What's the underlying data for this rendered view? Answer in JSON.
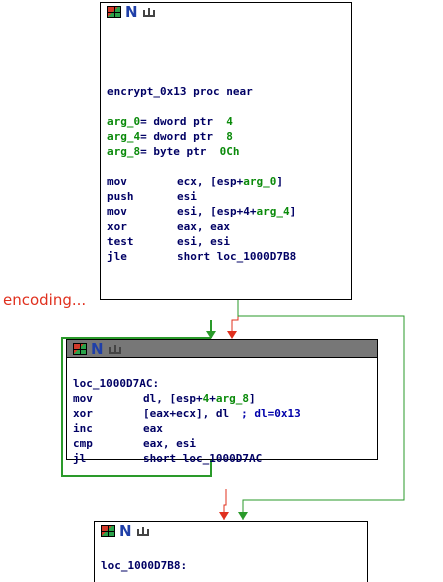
{
  "colors": {
    "edge_true": "#e0301e",
    "edge_false": "#2a9a2a",
    "edge_loop": "#2a9a2a",
    "text": "#000064",
    "arg": "#0a8a0a"
  },
  "annotation": "encoding...",
  "icons": [
    "grid-icon",
    "n-icon",
    "graph-icon"
  ],
  "block1": {
    "proc": "encrypt_0x13 proc near",
    "args": [
      {
        "name": "arg_0",
        "decl": "= dword ptr  ",
        "val": "4"
      },
      {
        "name": "arg_4",
        "decl": "= dword ptr  ",
        "val": "8"
      },
      {
        "name": "arg_8",
        "decl": "= byte ptr  ",
        "val": "0Ch"
      }
    ],
    "instr": [
      {
        "op": "mov",
        "a": "ecx, [esp+",
        "arg": "arg_0",
        "b": "]"
      },
      {
        "op": "push",
        "a": "esi",
        "arg": "",
        "b": ""
      },
      {
        "op": "mov",
        "a": "esi, [esp+4+",
        "arg": "arg_4",
        "b": "]"
      },
      {
        "op": "xor",
        "a": "eax, eax",
        "arg": "",
        "b": ""
      },
      {
        "op": "test",
        "a": "esi, esi",
        "arg": "",
        "b": ""
      },
      {
        "op": "jle",
        "a": "short loc_1000D7B8",
        "arg": "",
        "b": ""
      }
    ]
  },
  "block2": {
    "label": "loc_1000D7AC:",
    "instr": [
      {
        "op": "mov",
        "a": "dl, [esp+",
        "n": "4",
        "plus": "+",
        "arg": "arg_8",
        "b": "]",
        "c": ""
      },
      {
        "op": "xor",
        "a": "[eax+ecx], dl",
        "n": "",
        "plus": "",
        "arg": "",
        "b": "",
        "c": "; dl=0x13"
      },
      {
        "op": "inc",
        "a": "eax",
        "n": "",
        "plus": "",
        "arg": "",
        "b": "",
        "c": ""
      },
      {
        "op": "cmp",
        "a": "eax, esi",
        "n": "",
        "plus": "",
        "arg": "",
        "b": "",
        "c": ""
      },
      {
        "op": "jl",
        "a": "short loc_1000D7AC",
        "n": "",
        "plus": "",
        "arg": "",
        "b": "",
        "c": ""
      }
    ]
  },
  "block3": {
    "label": "loc_1000D7B8:"
  }
}
